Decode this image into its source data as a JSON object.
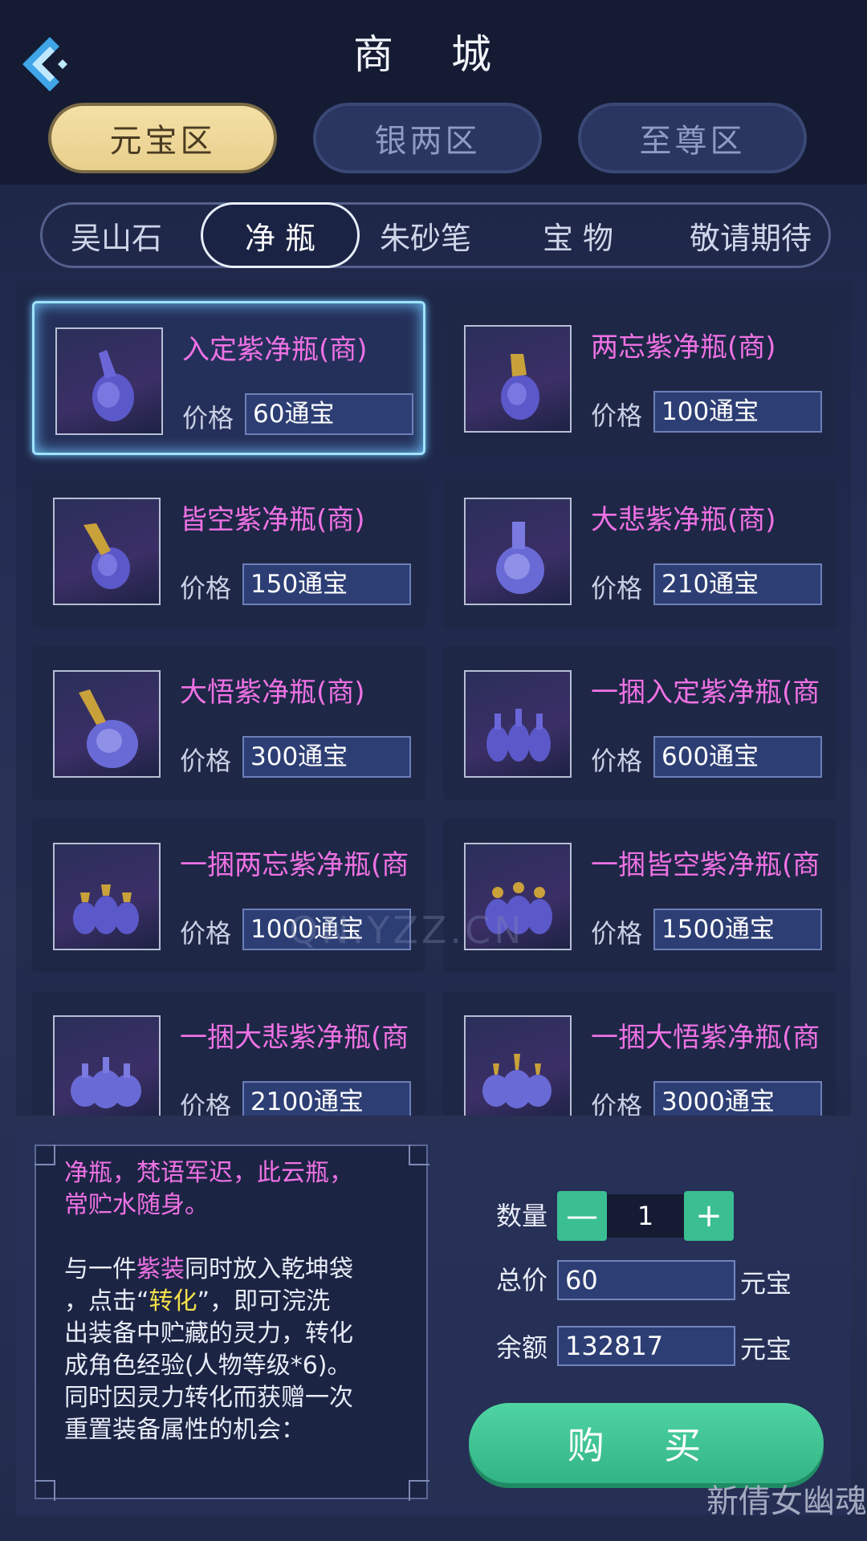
{
  "header": {
    "title": "商 城"
  },
  "category_tabs": [
    {
      "label": "元宝区",
      "active": true
    },
    {
      "label": "银两区",
      "active": false
    },
    {
      "label": "至尊区",
      "active": false
    }
  ],
  "sub_tabs": [
    {
      "label": "吴山石",
      "active": false
    },
    {
      "label": "净 瓶",
      "active": true
    },
    {
      "label": "朱砂笔",
      "active": false
    },
    {
      "label": "宝 物",
      "active": false
    },
    {
      "label": "敬请期待",
      "active": false
    }
  ],
  "price_label": "价格",
  "items": [
    {
      "name": "入定紫净瓶(商)",
      "price": "60通宝",
      "selected": true
    },
    {
      "name": "两忘紫净瓶(商)",
      "price": "100通宝"
    },
    {
      "name": "皆空紫净瓶(商)",
      "price": "150通宝"
    },
    {
      "name": "大悲紫净瓶(商)",
      "price": "210通宝"
    },
    {
      "name": "大悟紫净瓶(商)",
      "price": "300通宝"
    },
    {
      "name": "一捆入定紫净瓶(商",
      "price": "600通宝"
    },
    {
      "name": "一捆两忘紫净瓶(商",
      "price": "1000通宝"
    },
    {
      "name": "一捆皆空紫净瓶(商",
      "price": "1500通宝"
    },
    {
      "name": "一捆大悲紫净瓶(商",
      "price": "2100通宝"
    },
    {
      "name": "一捆大悟紫净瓶(商",
      "price": "3000通宝"
    }
  ],
  "description": {
    "line1": "净瓶，梵语军迟，此云瓶，",
    "line2": "常贮水随身。",
    "p2_a": "与一件",
    "p2_b": "紫装",
    "p2_c": "同时放入乾坤袋",
    "p2_d": "，点击“",
    "p2_e": "转化",
    "p2_f": "”，即可浣洗",
    "p2_g": "出装备中贮藏的灵力，转化",
    "p2_h": "成角色经验(人物等级*6)。",
    "p2_i": "同时因灵力转化而获赠一次",
    "p2_j": "重置装备属性的机会："
  },
  "purchase": {
    "qty_label": "数量",
    "qty_minus": "—",
    "qty_value": "1",
    "qty_plus": "+",
    "total_label": "总价",
    "total_value": "60",
    "balance_label": "余额",
    "balance_value": "132817",
    "currency": "元宝",
    "buy_label": "购 买"
  },
  "watermarks": {
    "logo": "新倩女幽魂",
    "site": "QN.YZZ.CN"
  },
  "colors": {
    "accent_pink": "#ef72e4",
    "buy_green": "#3bbf92",
    "active_tab_gold": "#f4e0a6"
  }
}
